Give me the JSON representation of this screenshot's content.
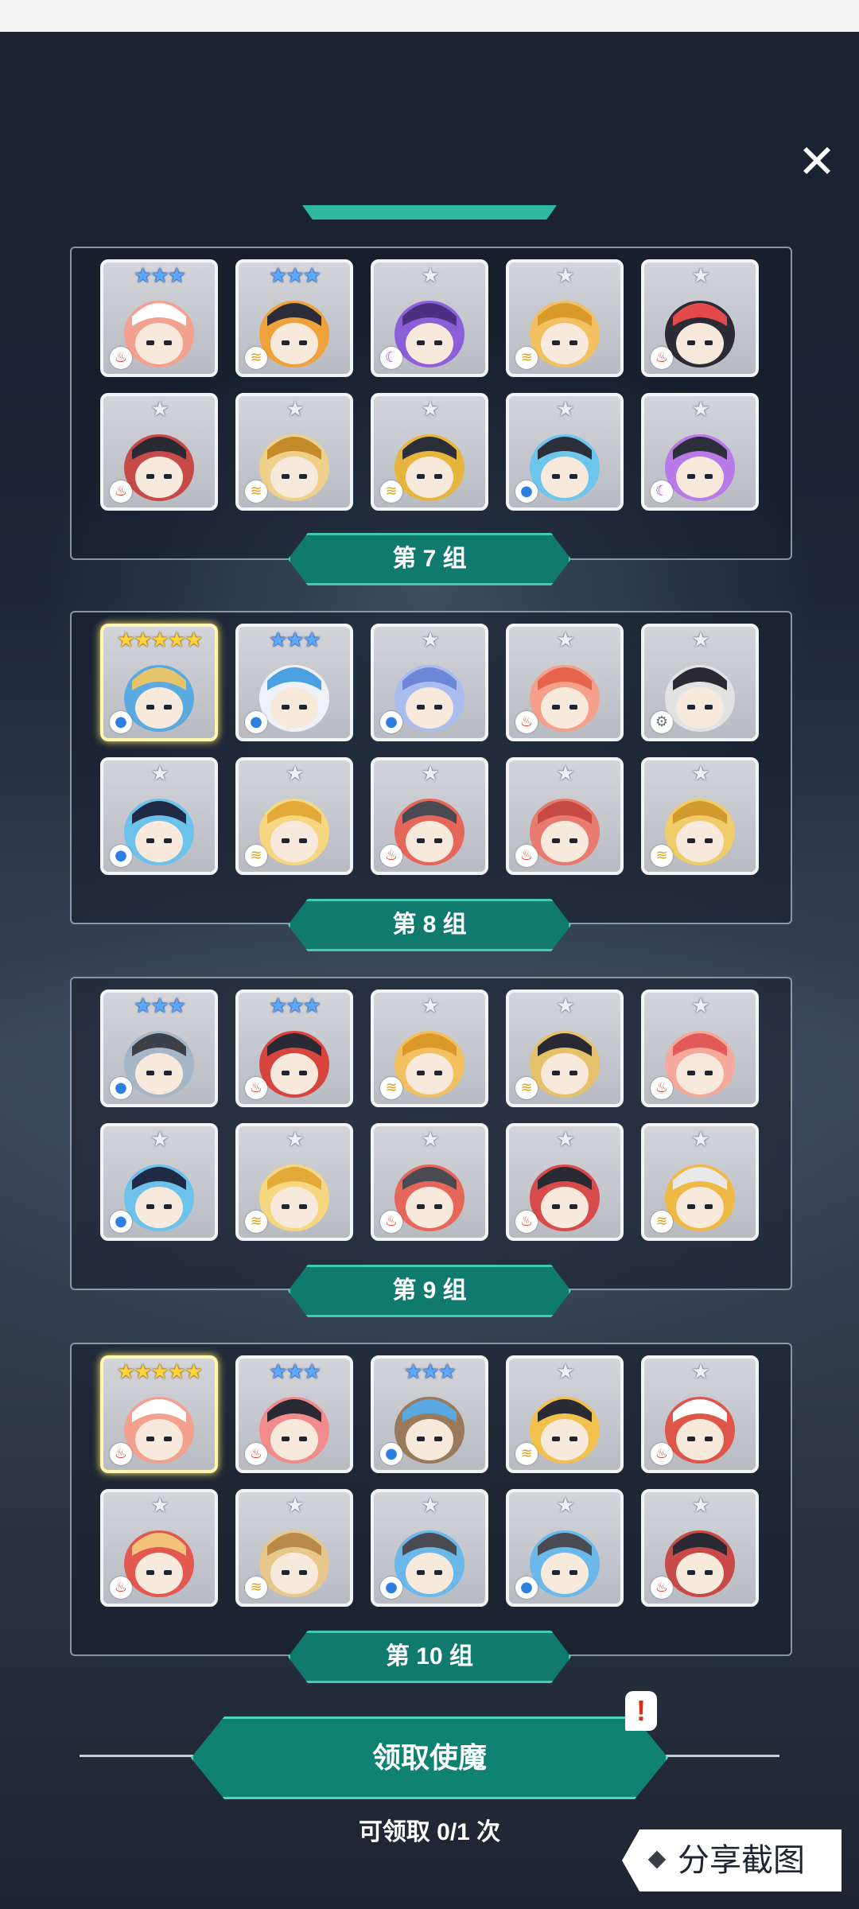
{
  "header": {
    "close_symbol": "✕"
  },
  "groups": [
    {
      "label": "第 7 组",
      "cards": [
        {
          "stars": 3,
          "element": "fire",
          "bg": "#f3a18f",
          "accent": "#ffffff"
        },
        {
          "stars": 3,
          "element": "wind",
          "bg": "#f0a23a",
          "accent": "#2b2b3a"
        },
        {
          "stars": 1,
          "element": "dark",
          "bg": "#8c5fd8",
          "accent": "#4b2f80"
        },
        {
          "stars": 1,
          "element": "wind",
          "bg": "#f2c060",
          "accent": "#d99a2a"
        },
        {
          "stars": 1,
          "element": "fire",
          "bg": "#2c2a34",
          "accent": "#e44a4a"
        },
        {
          "stars": 1,
          "element": "fire",
          "bg": "#c84a48",
          "accent": "#2a2a34"
        },
        {
          "stars": 1,
          "element": "wind",
          "bg": "#efd08a",
          "accent": "#c58a2a"
        },
        {
          "stars": 1,
          "element": "wind",
          "bg": "#e8b53c",
          "accent": "#2a2f3a"
        },
        {
          "stars": 1,
          "element": "water",
          "bg": "#6ec6ec",
          "accent": "#2a2f3a"
        },
        {
          "stars": 1,
          "element": "dark",
          "bg": "#b77ae6",
          "accent": "#2a2f3a"
        }
      ]
    },
    {
      "label": "第 8 组",
      "cards": [
        {
          "stars": 5,
          "element": "water",
          "bg": "#5aa9e0",
          "accent": "#e6c56a"
        },
        {
          "stars": 3,
          "element": "water",
          "bg": "#eef2f8",
          "accent": "#4aa0e0"
        },
        {
          "stars": 1,
          "element": "water",
          "bg": "#a9bdf0",
          "accent": "#6e86d8"
        },
        {
          "stars": 1,
          "element": "fire",
          "bg": "#f4a08a",
          "accent": "#e6644e"
        },
        {
          "stars": 1,
          "element": "gear",
          "bg": "#e2e2e2",
          "accent": "#2a2a34"
        },
        {
          "stars": 1,
          "element": "water",
          "bg": "#6cc2ea",
          "accent": "#1f2b44"
        },
        {
          "stars": 1,
          "element": "wind",
          "bg": "#f7d680",
          "accent": "#e2a838"
        },
        {
          "stars": 1,
          "element": "fire",
          "bg": "#e6665a",
          "accent": "#4a4a52"
        },
        {
          "stars": 1,
          "element": "fire",
          "bg": "#e87a70",
          "accent": "#c64a44"
        },
        {
          "stars": 1,
          "element": "wind",
          "bg": "#f0cc6a",
          "accent": "#d29a2e"
        }
      ]
    },
    {
      "label": "第 9 组",
      "cards": [
        {
          "stars": 3,
          "element": "water",
          "bg": "#a5b7c6",
          "accent": "#3a3f48"
        },
        {
          "stars": 3,
          "element": "fire",
          "bg": "#d8443e",
          "accent": "#2a2a34"
        },
        {
          "stars": 1,
          "element": "wind",
          "bg": "#f2c060",
          "accent": "#d99a2a"
        },
        {
          "stars": 1,
          "element": "wind",
          "bg": "#e7c06a",
          "accent": "#2a2a34"
        },
        {
          "stars": 1,
          "element": "fire",
          "bg": "#f5a99a",
          "accent": "#e35a5a"
        },
        {
          "stars": 1,
          "element": "water",
          "bg": "#6cc2ea",
          "accent": "#1f2b44"
        },
        {
          "stars": 1,
          "element": "wind",
          "bg": "#f7d680",
          "accent": "#e2a838"
        },
        {
          "stars": 1,
          "element": "fire",
          "bg": "#e6665a",
          "accent": "#4a4a52"
        },
        {
          "stars": 1,
          "element": "fire",
          "bg": "#d94a4a",
          "accent": "#2a2a34"
        },
        {
          "stars": 1,
          "element": "wind",
          "bg": "#f0b844",
          "accent": "#e8e8e8"
        }
      ]
    },
    {
      "label": "第 10 组",
      "cards": [
        {
          "stars": 5,
          "element": "fire",
          "bg": "#f3a18f",
          "accent": "#ffffff"
        },
        {
          "stars": 3,
          "element": "fire",
          "bg": "#f28c8c",
          "accent": "#2a2a34"
        },
        {
          "stars": 3,
          "element": "water",
          "bg": "#9a7a5a",
          "accent": "#5aa8e0"
        },
        {
          "stars": 1,
          "element": "wind",
          "bg": "#f2c04c",
          "accent": "#2a2a34"
        },
        {
          "stars": 1,
          "element": "fire",
          "bg": "#e0554a",
          "accent": "#ffffff"
        },
        {
          "stars": 1,
          "element": "fire",
          "bg": "#e2584e",
          "accent": "#f3c27a"
        },
        {
          "stars": 1,
          "element": "wind",
          "bg": "#e8c88a",
          "accent": "#b88a4a"
        },
        {
          "stars": 1,
          "element": "water",
          "bg": "#6bb8ea",
          "accent": "#4a4a52"
        },
        {
          "stars": 1,
          "element": "water",
          "bg": "#6bb8ea",
          "accent": "#4a4a52"
        },
        {
          "stars": 1,
          "element": "fire",
          "bg": "#c84a48",
          "accent": "#2a2a34"
        }
      ]
    }
  ],
  "element_icons": {
    "fire": "fire-icon",
    "water": "water-drop-icon",
    "wind": "wind-icon",
    "dark": "moon-icon",
    "gear": "gear-icon"
  },
  "element_glyphs": {
    "fire": "♨",
    "water": "●",
    "wind": "≋",
    "dark": "☾",
    "gear": "⚙"
  },
  "footer": {
    "claim_button": "领取使魔",
    "alert_symbol": "!",
    "claim_count": "可领取 0/1 次",
    "share_button": "分享截图"
  }
}
